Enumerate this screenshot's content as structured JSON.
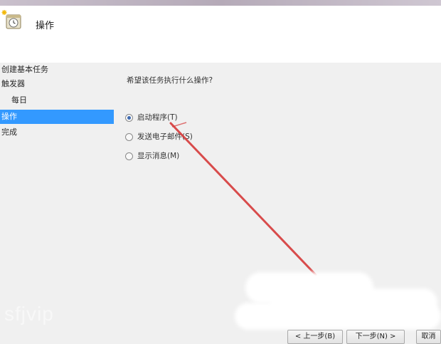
{
  "window": {
    "title": "操作",
    "icon": "task-clock-icon"
  },
  "sidebar": {
    "steps": [
      {
        "label": "创建基本任务",
        "level": 0,
        "active": false
      },
      {
        "label": "触发器",
        "level": 0,
        "active": false
      },
      {
        "label": "每日",
        "level": 1,
        "active": false
      },
      {
        "label": "操作",
        "level": 0,
        "active": true
      },
      {
        "label": "完成",
        "level": 0,
        "active": false
      }
    ]
  },
  "content": {
    "question": "希望该任务执行什么操作?",
    "options": [
      {
        "label": "启动程序(T)",
        "checked": true
      },
      {
        "label": "发送电子邮件(S)",
        "checked": false
      },
      {
        "label": "显示消息(M)",
        "checked": false
      }
    ]
  },
  "buttons": {
    "back": "< 上一步(B)",
    "next": "下一步(N) >",
    "cancel": "取消"
  },
  "watermark": "sfjvip",
  "colors": {
    "accent": "#3399ff",
    "annotation_arrow": "#d63a3a"
  }
}
